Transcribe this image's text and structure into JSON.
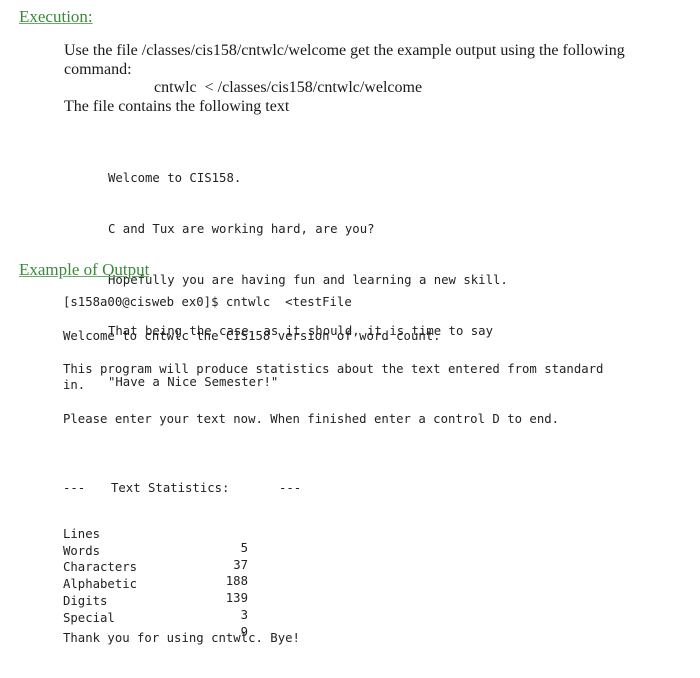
{
  "execution": {
    "heading": "Execution:",
    "intro_line1": "Use the file /classes/cis158/cntwlc/welcome get the example output using the following",
    "intro_line2": "command:",
    "command": "cntwlc  < /classes/cis158/cntwlc/welcome",
    "file_contains": "The file contains the following text",
    "file_text": [
      "Welcome to CIS158.",
      "C and Tux are working hard, are you?",
      "Hopefully you are having fun and learning a new skill.",
      "That being the case, as it should, it is time to say",
      "\"Have a Nice Semester!\""
    ]
  },
  "example_output": {
    "heading": "Example of Output",
    "prompt": "[s158a00@cisweb ex0]$ cntwlc  <testFile",
    "welcome": "Welcome to cntwlc the CIS158 version of word count.",
    "description_line1": "This program will produce statistics about the text entered from standard",
    "description_line2": "in.",
    "instructions": "Please enter your text now. When finished enter a control D to end.",
    "stats_header_left": "---",
    "stats_header_title": "Text Statistics:",
    "stats_header_right": "---",
    "stats": [
      {
        "label": "Lines",
        "value": "5"
      },
      {
        "label": "Words",
        "value": "37"
      },
      {
        "label": "Characters",
        "value": "188"
      },
      {
        "label": "Alphabetic",
        "value": "139"
      },
      {
        "label": "Digits",
        "value": "3"
      },
      {
        "label": "Special",
        "value": "9"
      }
    ],
    "goodbye": "Thank you for using cntwlc. Bye!"
  },
  "colors": {
    "heading": "#3b8a3b"
  }
}
